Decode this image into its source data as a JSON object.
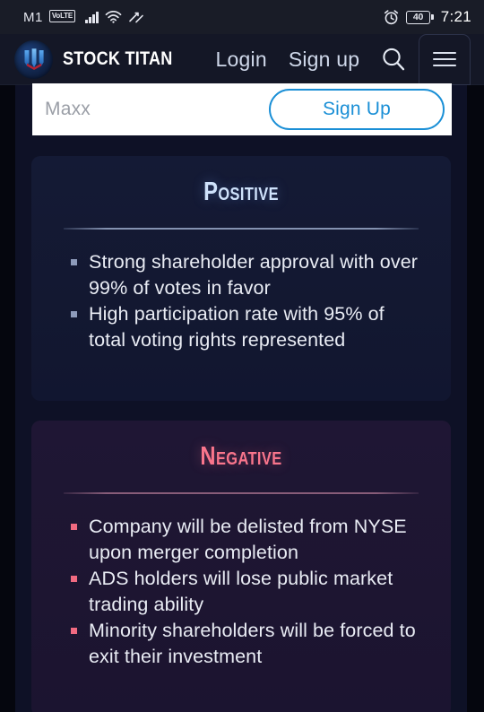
{
  "statusbar": {
    "carrier": "M1",
    "network_badge": "VoLTE",
    "signal_icon": "signal-bars-icon",
    "wifi_icon": "wifi-icon",
    "data_icon": "data-transfer-icon",
    "alarm_icon": "alarm-clock-icon",
    "battery_level": "40",
    "time": "7:21"
  },
  "header": {
    "logo_icon": "stock-titan-logo-icon",
    "brand": "STOCK TITAN",
    "login_label": "Login",
    "signup_label": "Sign up",
    "search_icon": "search-icon",
    "menu_icon": "hamburger-menu-icon"
  },
  "signup_strip": {
    "text": "Maxx",
    "button_label": "Sign Up",
    "accent_color": "#1a8fd6"
  },
  "cards": [
    {
      "id": "positive",
      "title": "Positive",
      "title_color": "#cfe2fb",
      "bullet_color": "#8e9bbb",
      "bullets": [
        "Strong shareholder approval with over 99% of votes in favor",
        "High participation rate with 95% of total voting rights represented"
      ]
    },
    {
      "id": "negative",
      "title": "Negative",
      "title_color": "#f9758c",
      "bullet_color": "#f06a81",
      "bullets": [
        "Company will be delisted from NYSE upon merger completion",
        "ADS holders will lose public market trading ability",
        "Minority shareholders will be forced to exit their investment"
      ]
    }
  ]
}
